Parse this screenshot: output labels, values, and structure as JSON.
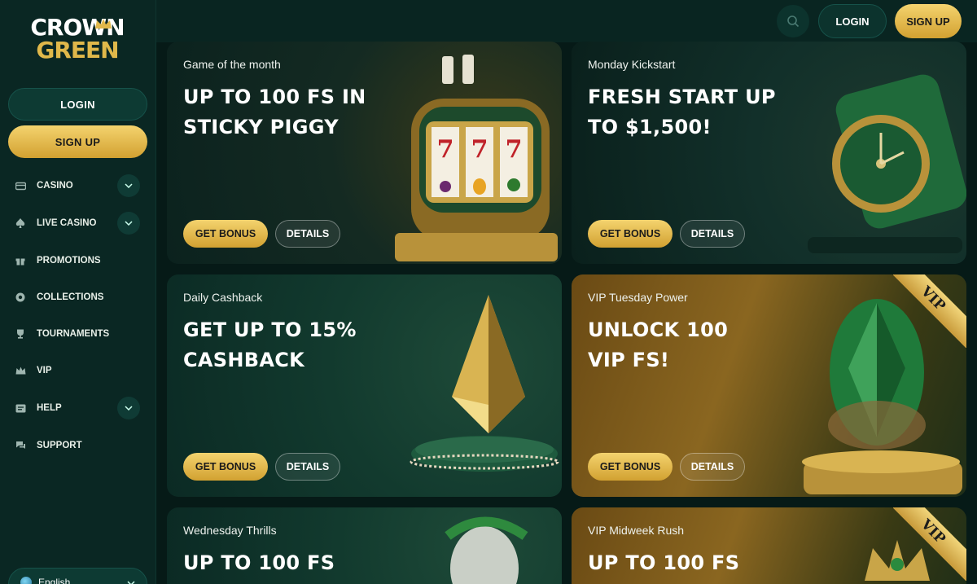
{
  "brand": {
    "line1": "CROWN",
    "line2": "GREEN",
    "gold": "#e0b84a"
  },
  "header": {
    "login": "LOGIN",
    "signup": "SIGN UP",
    "search_icon": "search-icon"
  },
  "sidebar": {
    "login": "LOGIN",
    "signup": "SIGN UP",
    "items": [
      {
        "label": "CASINO",
        "icon": "card-icon",
        "expandable": true
      },
      {
        "label": "LIVE CASINO",
        "icon": "spade-icon",
        "expandable": true
      },
      {
        "label": "PROMOTIONS",
        "icon": "gift-icon",
        "expandable": false
      },
      {
        "label": "COLLECTIONS",
        "icon": "chip-icon",
        "expandable": false
      },
      {
        "label": "TOURNAMENTS",
        "icon": "trophy-icon",
        "expandable": false
      },
      {
        "label": "VIP",
        "icon": "crown-icon",
        "expandable": false
      },
      {
        "label": "HELP",
        "icon": "help-icon",
        "expandable": true
      },
      {
        "label": "SUPPORT",
        "icon": "chat-icon",
        "expandable": false
      }
    ],
    "language": "English"
  },
  "promos": [
    {
      "subtitle": "Game of the month",
      "title": "UP TO 100 FS IN STICKY PIGGY",
      "bonus": "GET BONUS",
      "details": "DETAILS"
    },
    {
      "subtitle": "Monday Kickstart",
      "title": "FRESH START UP TO $1,500!",
      "bonus": "GET BONUS",
      "details": "DETAILS"
    },
    {
      "subtitle": "Daily Cashback",
      "title": "GET UP TO 15% CASHBACK",
      "bonus": "GET BONUS",
      "details": "DETAILS"
    },
    {
      "subtitle": "VIP Tuesday Power",
      "title": "UNLOCK 100 VIP FS!",
      "bonus": "GET BONUS",
      "details": "DETAILS",
      "badge": "VIP"
    },
    {
      "subtitle": "Wednesday Thrills",
      "title": "UP TO 100 FS"
    },
    {
      "subtitle": "VIP Midweek Rush",
      "title": "UP TO 100 FS",
      "badge": "VIP"
    }
  ]
}
